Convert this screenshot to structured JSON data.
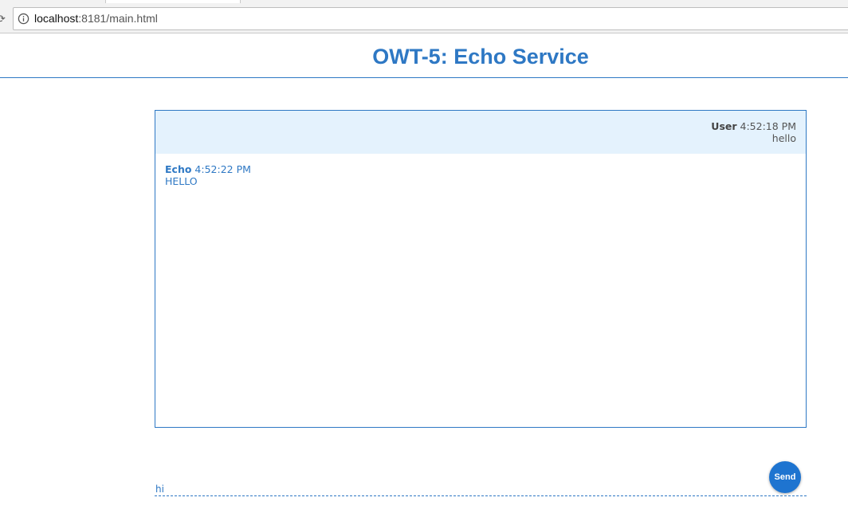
{
  "browser": {
    "url_host": "localhost",
    "url_rest": ":8181/main.html"
  },
  "page": {
    "title": "OWT-5: Echo Service"
  },
  "messages": [
    {
      "sender": "User",
      "time": "4:52:18 PM",
      "text": "hello"
    },
    {
      "sender": "Echo",
      "time": "4:52:22 PM",
      "text": "HELLO"
    }
  ],
  "composer": {
    "input_value": "hi",
    "send_label": "Send"
  },
  "colors": {
    "accent": "#2e78c4",
    "user_bubble": "#e4f2fd",
    "send_button": "#1e74d0"
  }
}
